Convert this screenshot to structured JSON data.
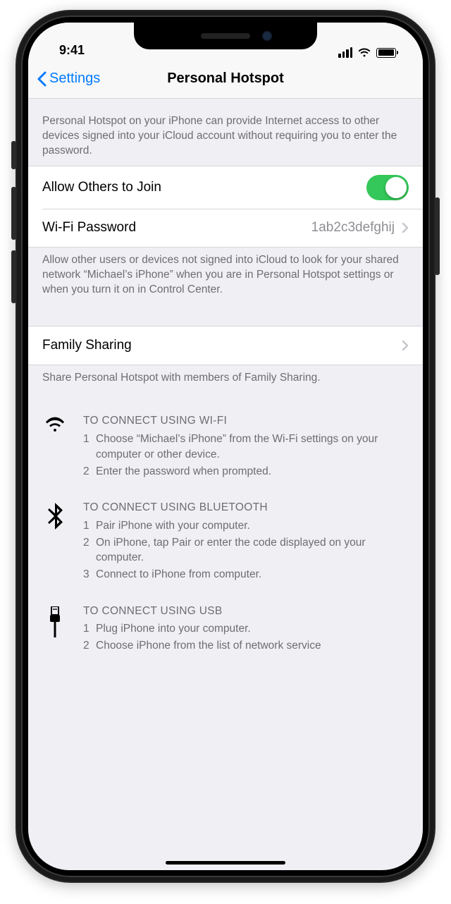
{
  "status": {
    "time": "9:41"
  },
  "nav": {
    "back_label": "Settings",
    "title": "Personal Hotspot"
  },
  "intro": "Personal Hotspot on your iPhone can provide Internet access to other devices signed into your iCloud account without requiring you to enter the password.",
  "rows": {
    "allow_label": "Allow Others to Join",
    "password_label": "Wi-Fi Password",
    "password_value": "1ab2c3defghij",
    "family_label": "Family Sharing"
  },
  "allow_desc": "Allow other users or devices not signed into iCloud to look for your shared network “Michael’s iPhone” when you are in Personal Hotspot settings or when you turn it on in Control Center.",
  "family_desc": "Share Personal Hotspot with members of Family Sharing.",
  "instructions": {
    "wifi": {
      "heading": "TO CONNECT USING WI-FI",
      "steps": [
        "Choose “Michael’s iPhone” from the Wi-Fi settings on your computer or other device.",
        "Enter the password when prompted."
      ]
    },
    "bluetooth": {
      "heading": "TO CONNECT USING BLUETOOTH",
      "steps": [
        "Pair iPhone with your computer.",
        "On iPhone, tap Pair or enter the code displayed on your computer.",
        "Connect to iPhone from computer."
      ]
    },
    "usb": {
      "heading": "TO CONNECT USING USB",
      "steps": [
        "Plug iPhone into your computer.",
        "Choose iPhone from the list of network service"
      ]
    }
  }
}
